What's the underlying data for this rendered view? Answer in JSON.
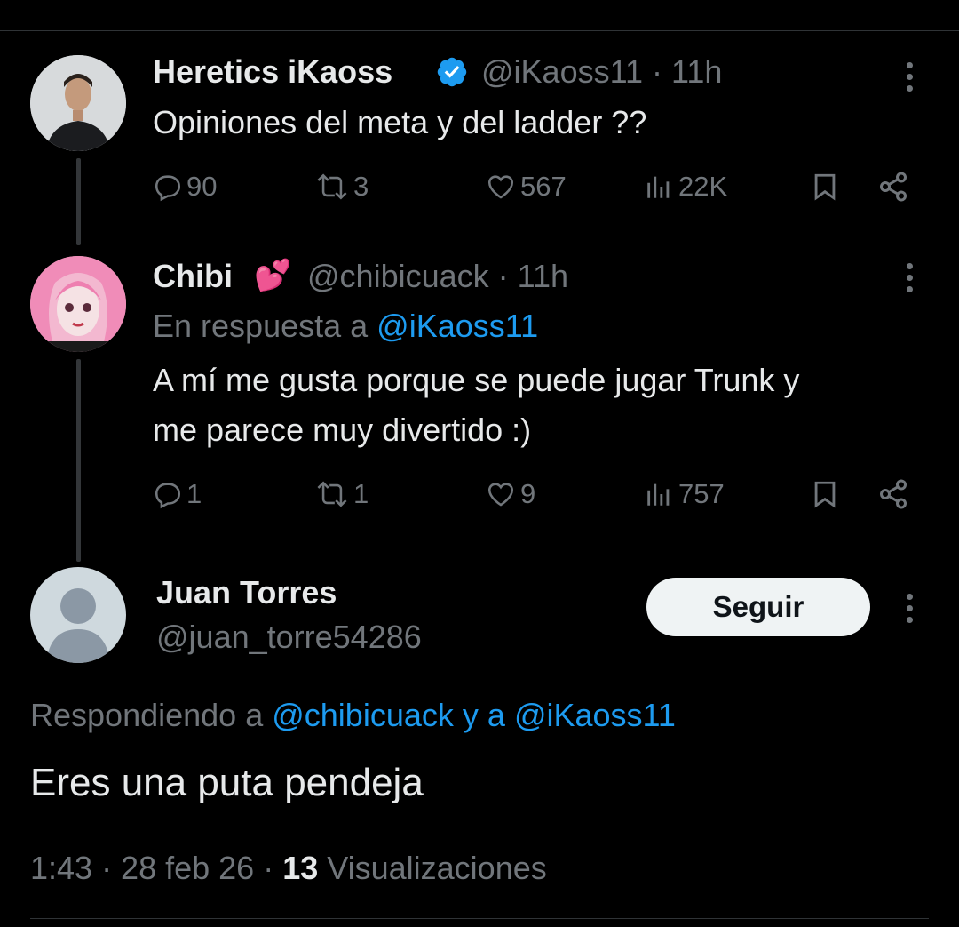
{
  "tweets": [
    {
      "name": "Heretics iKaoss",
      "handle": "@iKaoss11",
      "time": "· 11h",
      "text": "Opiniones del meta y del ladder ??",
      "stats": {
        "replies": "90",
        "reposts": "3",
        "likes": "567",
        "views": "22K"
      }
    },
    {
      "name": "Chibi",
      "emoji": "💕",
      "handle": "@chibicuack",
      "time": "· 11h",
      "reply_prefix": "En respuesta a",
      "reply_to": "@iKaoss11",
      "text_line1": "A mí me gusta porque se puede jugar Trunk y",
      "text_line2": "me parece muy divertido :)",
      "stats": {
        "replies": "1",
        "reposts": "1",
        "likes": "9",
        "views": "757"
      }
    }
  ],
  "main_tweet": {
    "name": "Juan Torres",
    "handle": "@juan_torre54286",
    "follow_label": "Seguir",
    "replying_prefix": "Respondiendo a",
    "replying_to_1": "@chibicuack",
    "replying_joiner": "y a",
    "replying_to_2": "@iKaoss11",
    "text": "Eres una puta pendeja",
    "time": "1:43 · 28 feb 26 ·",
    "views_count": "13",
    "views_label": "Visualizaciones"
  },
  "colors": {
    "background": "#000000",
    "text": "#e7e9ea",
    "muted": "#71767b",
    "link": "#1d9bf0",
    "verified": "#1d9bf0"
  }
}
